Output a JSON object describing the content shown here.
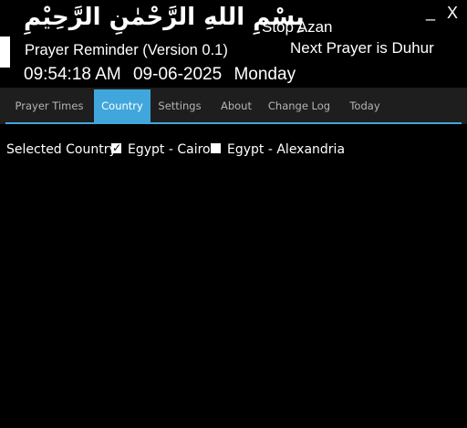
{
  "header": {
    "bismillah": "بِسْمِ اللهِ الرَّحْمٰنِ الرَّحِيْمِ",
    "app_title": "Prayer Reminder (Version 0.1)",
    "time": "09:54:18 AM",
    "date": "09-06-2025",
    "day": "Monday",
    "stop_azan": "Stop Azan",
    "next_prayer": "Next Prayer is Duhur",
    "minimize": "_",
    "close": "X"
  },
  "tabs": [
    {
      "label": "Prayer Times",
      "active": false
    },
    {
      "label": "Country",
      "active": true
    },
    {
      "label": "Settings",
      "active": false
    },
    {
      "label": "About",
      "active": false
    },
    {
      "label": "Change Log",
      "active": false
    },
    {
      "label": "Today",
      "active": false
    }
  ],
  "country": {
    "selected_label": "Selected Country",
    "options": [
      {
        "label": "Egypt - Cairo",
        "checked": true
      },
      {
        "label": "Egypt - Alexandria",
        "checked": false
      }
    ]
  },
  "colors": {
    "accent": "#41a6dc",
    "background": "#000000",
    "tabbar": "#1e1e1e"
  }
}
